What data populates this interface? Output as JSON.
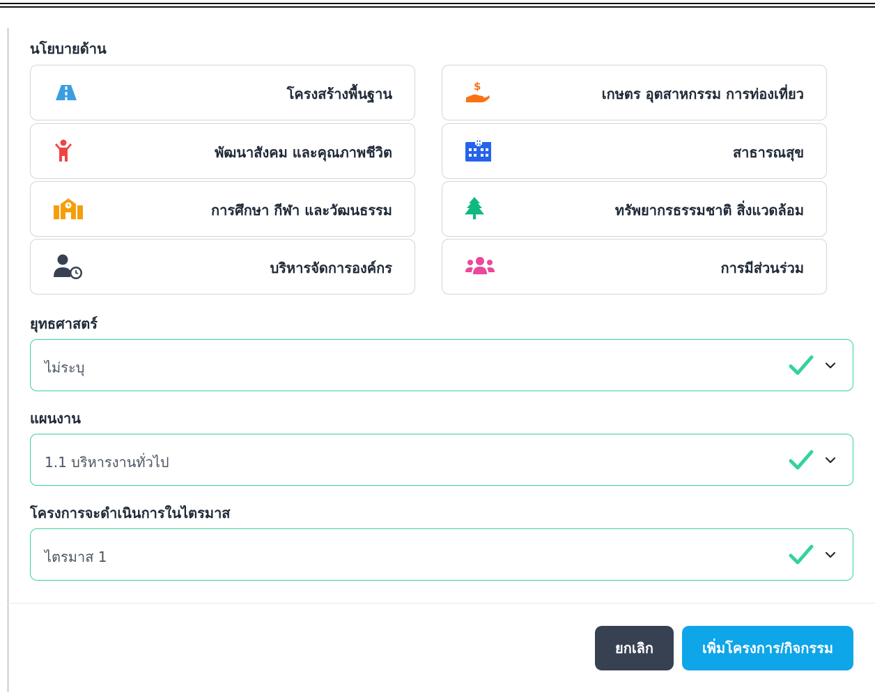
{
  "colors": {
    "accent_green": "#34d399",
    "cancel_bg": "#374151",
    "primary_bg": "#0ea5e9"
  },
  "policy": {
    "heading": "นโยบายด้าน",
    "items": [
      {
        "label": "โครงสร้างพื้นฐาน",
        "icon": "road-icon",
        "color": "#3b9ee0"
      },
      {
        "label": "เกษตร อุตสาหกรรม การท่องเที่ยว",
        "icon": "hand-money-icon",
        "color": "#f97316"
      },
      {
        "label": "พัฒนาสังคม และคุณภาพชีวิต",
        "icon": "child-icon",
        "color": "#ef4444"
      },
      {
        "label": "สาธารณสุข",
        "icon": "hospital-icon",
        "color": "#2563eb"
      },
      {
        "label": "การศึกษา กีฬา และวัฒนธรรม",
        "icon": "school-icon",
        "color": "#f59e0b"
      },
      {
        "label": "ทรัพยากรธรรมชาติ สิ่งแวดล้อม",
        "icon": "tree-icon",
        "color": "#10b981"
      },
      {
        "label": "บริหารจัดการองค์กร",
        "icon": "user-clock-icon",
        "color": "#374151"
      },
      {
        "label": "การมีส่วนร่วม",
        "icon": "users-icon",
        "color": "#ec4899"
      }
    ]
  },
  "strategy": {
    "label": "ยุทธศาสตร์",
    "value": "ไม่ระบุ"
  },
  "plan": {
    "label": "แผนงาน",
    "value": "1.1 บริหารงานทั่วไป"
  },
  "quarter": {
    "label": "โครงการจะดำเนินการในไตรมาส",
    "value": "ไตรมาส 1"
  },
  "actions": {
    "cancel": "ยกเลิก",
    "submit": "เพิ่มโครงการ/กิจกรรม"
  }
}
